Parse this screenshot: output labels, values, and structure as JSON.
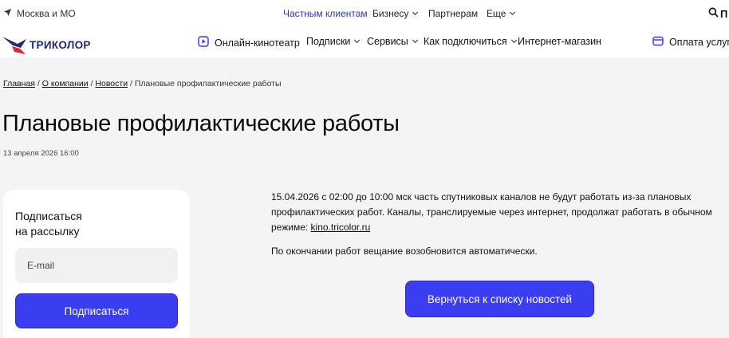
{
  "topbar": {
    "region": "Москва и МО",
    "segments": [
      {
        "label": "Частным клиентам",
        "active": true
      },
      {
        "label": "Бизнесу",
        "dropdown": true
      },
      {
        "label": "Партнерам"
      },
      {
        "label": "Еще",
        "dropdown": true
      }
    ],
    "search_label": "П",
    "icons": {
      "region": "location-arrow-icon",
      "search": "search-icon"
    }
  },
  "nav": {
    "logo_text": "ТРИКОЛОР",
    "items": [
      {
        "label": "Онлайн-кинотеатр",
        "icon": "play-icon"
      },
      {
        "label": "Подписки",
        "dropdown": true
      },
      {
        "label": "Сервисы",
        "dropdown": true
      },
      {
        "label": "Как подключиться",
        "dropdown": true
      },
      {
        "label": "Интернет-магазин"
      }
    ],
    "pay": {
      "label": "Оплата услуг",
      "icon": "wallet-icon"
    }
  },
  "breadcrumb": {
    "items": [
      "Главная",
      "О компании",
      "Новости"
    ],
    "current": "Плановые профилактические работы",
    "separator": "/"
  },
  "article": {
    "title": "Плановые профилактические работы",
    "date": "13 апреля 2026 16:00",
    "paragraph1": "15.04.2026 с 02:00 до 10:00 мск часть спутниковых каналов не будут работать из-за плановых профилактических работ. Каналы, транслируемые через интернет, продолжат работать в обычном режиме: ",
    "link": "kino.tricolor.ru",
    "paragraph2": "По окончании работ вещание возобновится автоматически.",
    "back_button": "Вернуться к списку новостей"
  },
  "subscribe": {
    "title": "Подписаться\nна рассылку",
    "email_placeholder": "E-mail",
    "button": "Подписаться"
  },
  "colors": {
    "accent": "#3a3df0",
    "brand_blue": "#1f2a6e",
    "brand_red": "#e4232d",
    "active_link": "#2a35c9",
    "background": "#f4f4f6"
  }
}
